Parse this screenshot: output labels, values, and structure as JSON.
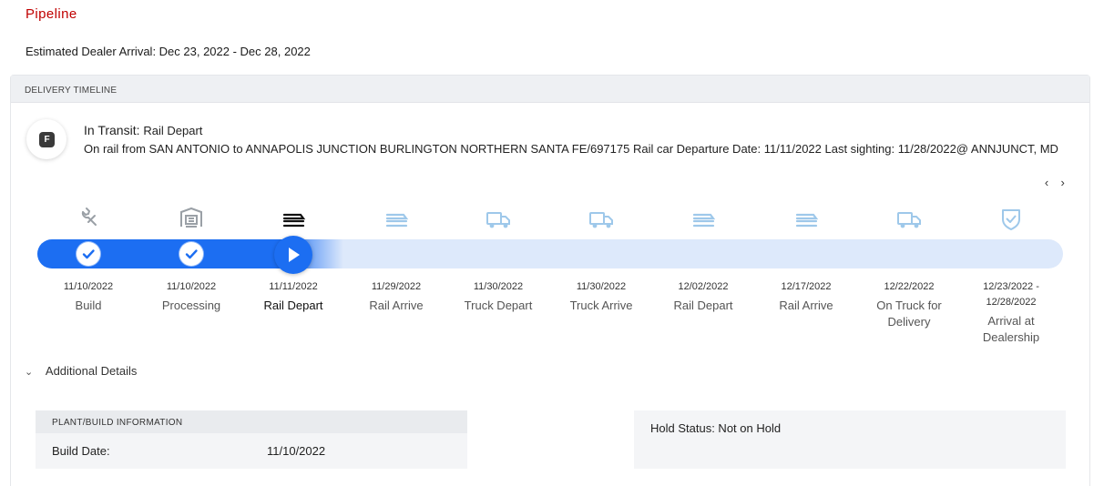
{
  "page": {
    "title": "Pipeline",
    "eta": "Estimated Dealer Arrival: Dec 23, 2022 - Dec 28, 2022"
  },
  "timeline": {
    "header": "DELIVERY TIMELINE",
    "status_badge": "F",
    "status_prefix": "In Transit:",
    "status_name": "Rail Depart",
    "status_desc": "On rail from SAN ANTONIO to ANNAPOLIS JUNCTION BURLINGTON NORTHERN SANTA FE/697175 Rail car Departure Date: 11/11/2022 Last sighting: 11/28/2022@ ANNJUNCT, MD",
    "pager_prev": "‹",
    "pager_next": "›",
    "steps": [
      {
        "date": "11/10/2022",
        "name": "Build",
        "icon": "wrench-icon",
        "state": "done"
      },
      {
        "date": "11/10/2022",
        "name": "Processing",
        "icon": "factory-icon",
        "state": "done"
      },
      {
        "date": "11/11/2022",
        "name": "Rail Depart",
        "icon": "train-icon",
        "state": "current"
      },
      {
        "date": "11/29/2022",
        "name": "Rail Arrive",
        "icon": "train-icon",
        "state": "pending"
      },
      {
        "date": "11/30/2022",
        "name": "Truck Depart",
        "icon": "truck-icon",
        "state": "pending"
      },
      {
        "date": "11/30/2022",
        "name": "Truck Arrive",
        "icon": "truck-icon",
        "state": "pending"
      },
      {
        "date": "12/02/2022",
        "name": "Rail Depart",
        "icon": "train-icon",
        "state": "pending"
      },
      {
        "date": "12/17/2022",
        "name": "Rail Arrive",
        "icon": "train-icon",
        "state": "pending"
      },
      {
        "date": "12/22/2022",
        "name": "On Truck for Delivery",
        "icon": "truck-icon",
        "state": "pending"
      },
      {
        "date": "12/23/2022 - 12/28/2022",
        "name": "Arrival at Dealership",
        "icon": "shield-check-icon",
        "state": "pending"
      }
    ]
  },
  "additional": {
    "toggle_label": "Additional Details",
    "plant": {
      "header": "PLANT/BUILD INFORMATION",
      "build_date_label": "Build Date:",
      "build_date_value": "11/10/2022"
    },
    "hold_status": "Hold Status: Not on Hold"
  },
  "colors": {
    "accent": "#1c6ef2",
    "track": "#dde9fb",
    "pending_icon": "#9ec8ea",
    "done_icon": "#9aa0a6",
    "title_red": "#c00000"
  }
}
